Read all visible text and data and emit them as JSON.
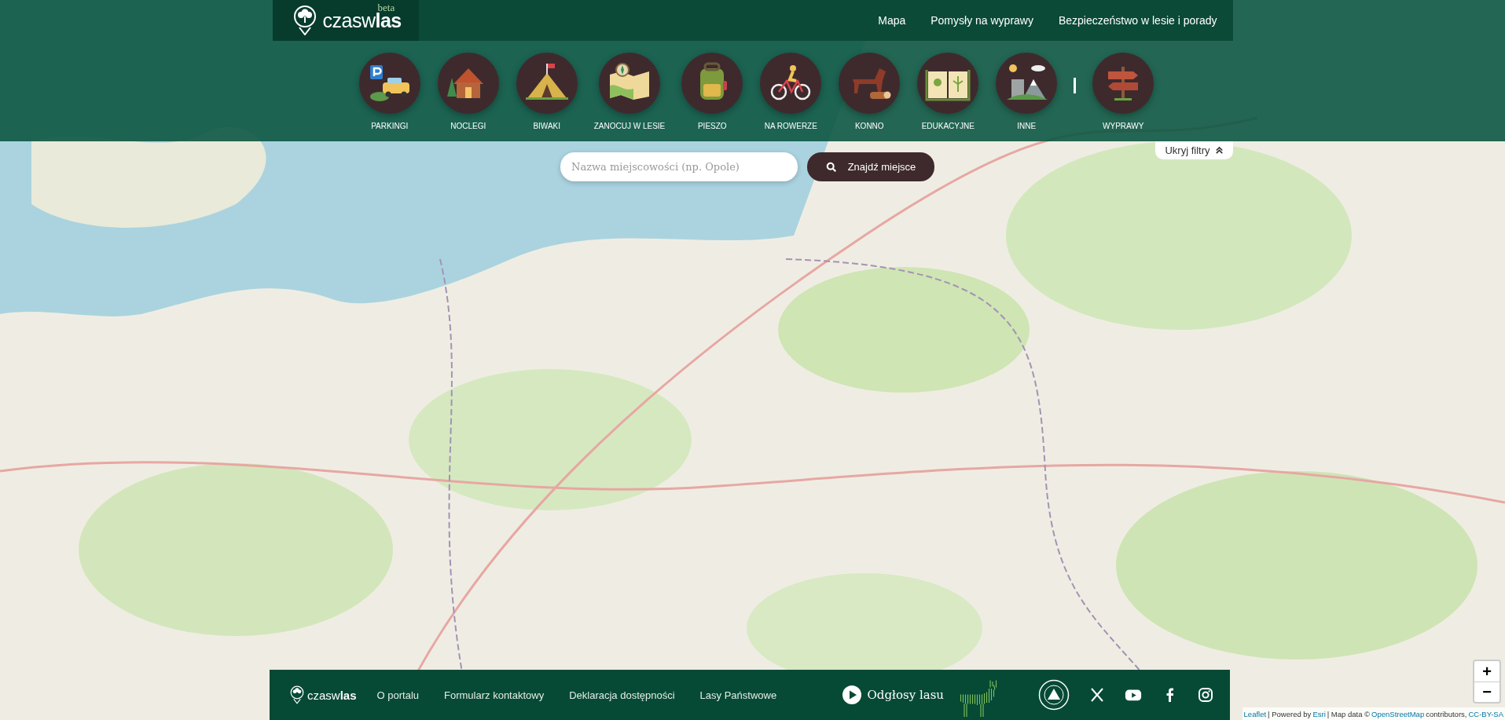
{
  "header": {
    "logo": {
      "text": "czasw**las**",
      "badge": "beta"
    },
    "nav": [
      {
        "label": "Mapa"
      },
      {
        "label": "Pomysły na wyprawy"
      },
      {
        "label": "Bezpieczeństwo w lesie i porady"
      }
    ]
  },
  "categories": [
    {
      "label": "PARKINGI"
    },
    {
      "label": "NOCLEGI"
    },
    {
      "label": "BIWAKI"
    },
    {
      "label": "ZANOCUJ W LESIE"
    },
    {
      "label": "PIESZO"
    },
    {
      "label": "NA ROWERZE"
    },
    {
      "label": "KONNO"
    },
    {
      "label": "EDUKACYJNE"
    },
    {
      "label": "INNE"
    },
    {
      "label": "WYPRAWY"
    }
  ],
  "search": {
    "placeholder": "Nazwa miejscowości (np. Opole)",
    "button": "Znajdź miejsce"
  },
  "filters_toggle": {
    "label": "Ukryj filtry",
    "expanded": true
  },
  "map": {
    "zoom_in": "+",
    "zoom_out": "−"
  },
  "attribution": [
    {
      "text": "Leaflet",
      "link": true
    },
    {
      "text": "| Powered by",
      "link": false
    },
    {
      "text": "Esri",
      "link": true
    },
    {
      "text": "| Map data ©",
      "link": false
    },
    {
      "text": "OpenStreetMap",
      "link": true
    },
    {
      "text": "contributors,",
      "link": false
    },
    {
      "text": "CC-BY-SA",
      "link": true
    }
  ],
  "footer": {
    "logo": "czasw**las**",
    "links": [
      {
        "label": "O portalu"
      },
      {
        "label": "Formularz kontaktowy"
      },
      {
        "label": "Deklaracja dostępności"
      },
      {
        "label": "Lasy Państwowe"
      }
    ],
    "sound": "Odgłosy lasu"
  }
}
